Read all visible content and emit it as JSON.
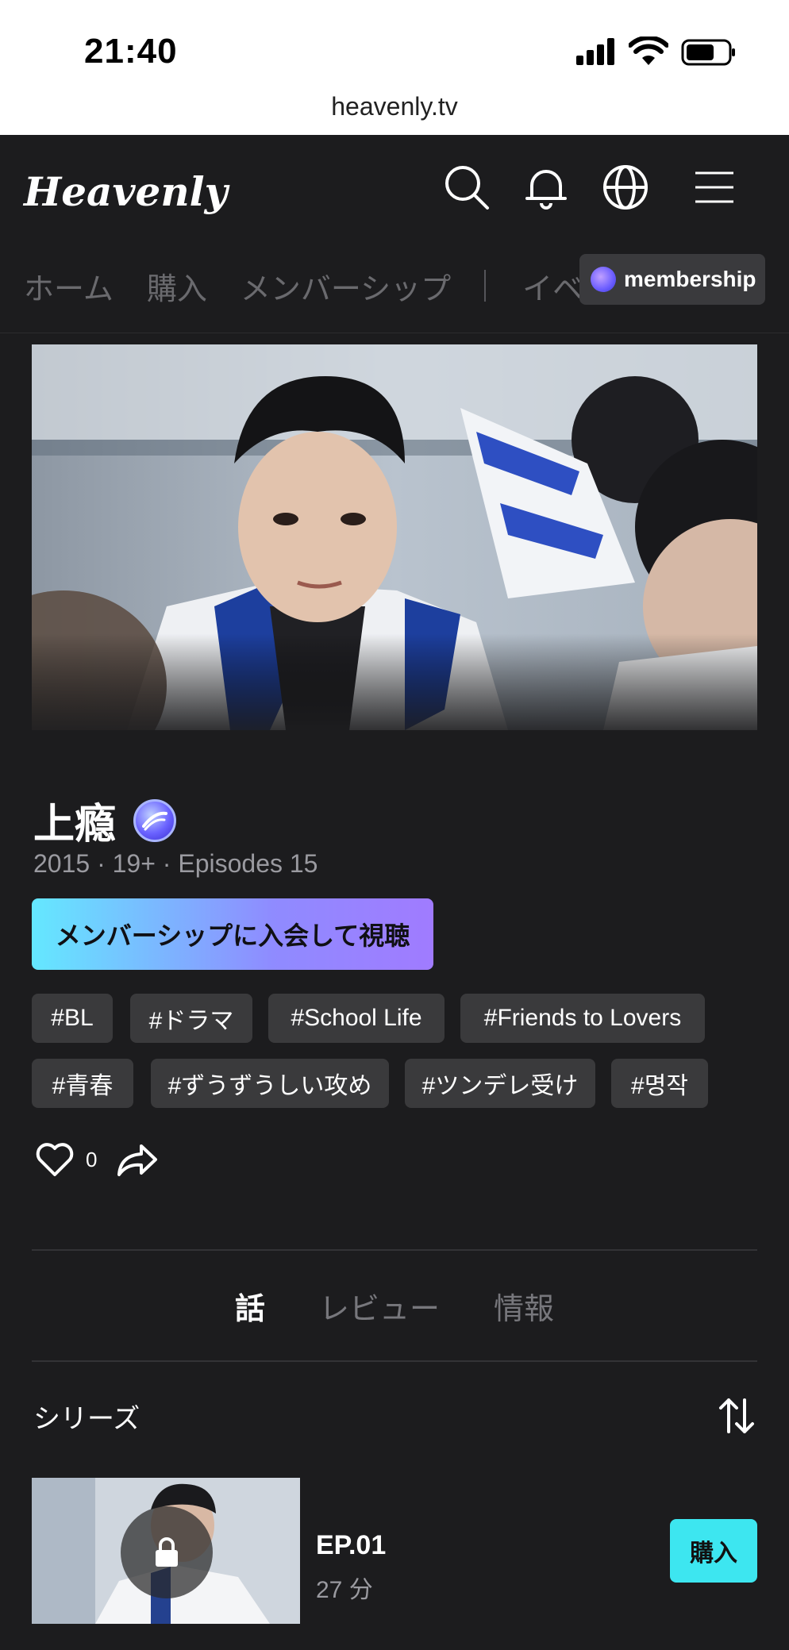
{
  "status_bar": {
    "time": "21:40",
    "url": "heavenly.tv"
  },
  "header": {
    "logo": "Heavenly",
    "icons": [
      "search-icon",
      "bell-icon",
      "globe-icon",
      "menu-icon"
    ]
  },
  "nav": {
    "items": [
      "ホーム",
      "購入",
      "メンバーシップ",
      "イベント"
    ],
    "membership_pill": "membership"
  },
  "show": {
    "title": "上瘾",
    "meta": "2015 · 19+ · Episodes 15",
    "cta_label": "メンバーシップに入会して視聴",
    "tags": [
      "#BL",
      "#ドラマ",
      "#School Life",
      "#Friends to Lovers",
      "#青春",
      "#ずうずうしい攻め",
      "#ツンデレ受け",
      "#명작"
    ],
    "likes": "0"
  },
  "tabs": [
    {
      "label": "話",
      "active": true
    },
    {
      "label": "レビュー",
      "active": false
    },
    {
      "label": "情報",
      "active": false
    }
  ],
  "series": {
    "label": "シリーズ",
    "episodes": [
      {
        "title": "EP.01",
        "duration": "27 分",
        "buy_label": "購入"
      }
    ]
  },
  "colors": {
    "background": "#1c1c1e",
    "cta_start": "#64e8ff",
    "cta_end": "#a07bff",
    "buy": "#3de6f0",
    "tag_bg": "#3a3a3c"
  }
}
